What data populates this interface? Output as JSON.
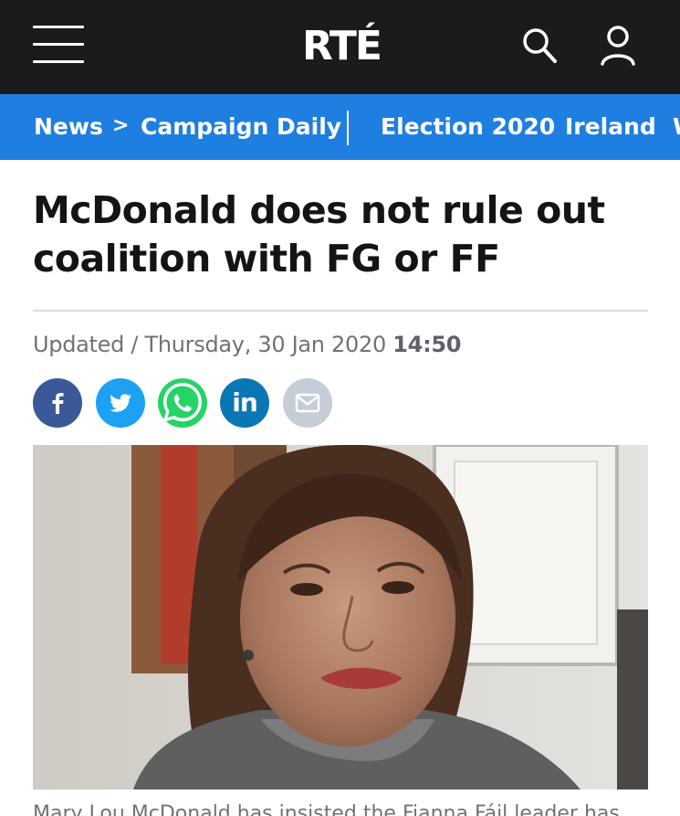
{
  "header": {
    "logo_text": "RTÉ",
    "menu_icon": "hamburger-menu-icon",
    "search_icon": "search-icon",
    "account_icon": "user-account-icon",
    "background": "#1b1b1b"
  },
  "nav": {
    "background": "#1f7fe0",
    "breadcrumb_root": "News",
    "separator": ">",
    "current_section": "Campaign Daily",
    "links": [
      "Election 2020",
      "Ireland",
      "W"
    ]
  },
  "article": {
    "headline": "McDonald does not rule out coalition with FG or FF",
    "updated_prefix": "Updated / Thursday, 30 Jan 2020",
    "updated_time": "14:50",
    "share_buttons": [
      {
        "name": "facebook",
        "glyph": "f",
        "color": "#3b5998"
      },
      {
        "name": "twitter",
        "icon": "twitter-bird-icon",
        "color": "#1da1f2"
      },
      {
        "name": "whatsapp",
        "icon": "whatsapp-icon",
        "color": "#25d366"
      },
      {
        "name": "linkedin",
        "glyph": "in",
        "color": "#0a77b5"
      },
      {
        "name": "email",
        "icon": "envelope-icon",
        "color": "#c5cdd8"
      }
    ],
    "image_alt": "Mary Lou McDonald",
    "caption": "Mary Lou McDonald has insisted the Fianna Fáil leader has"
  }
}
